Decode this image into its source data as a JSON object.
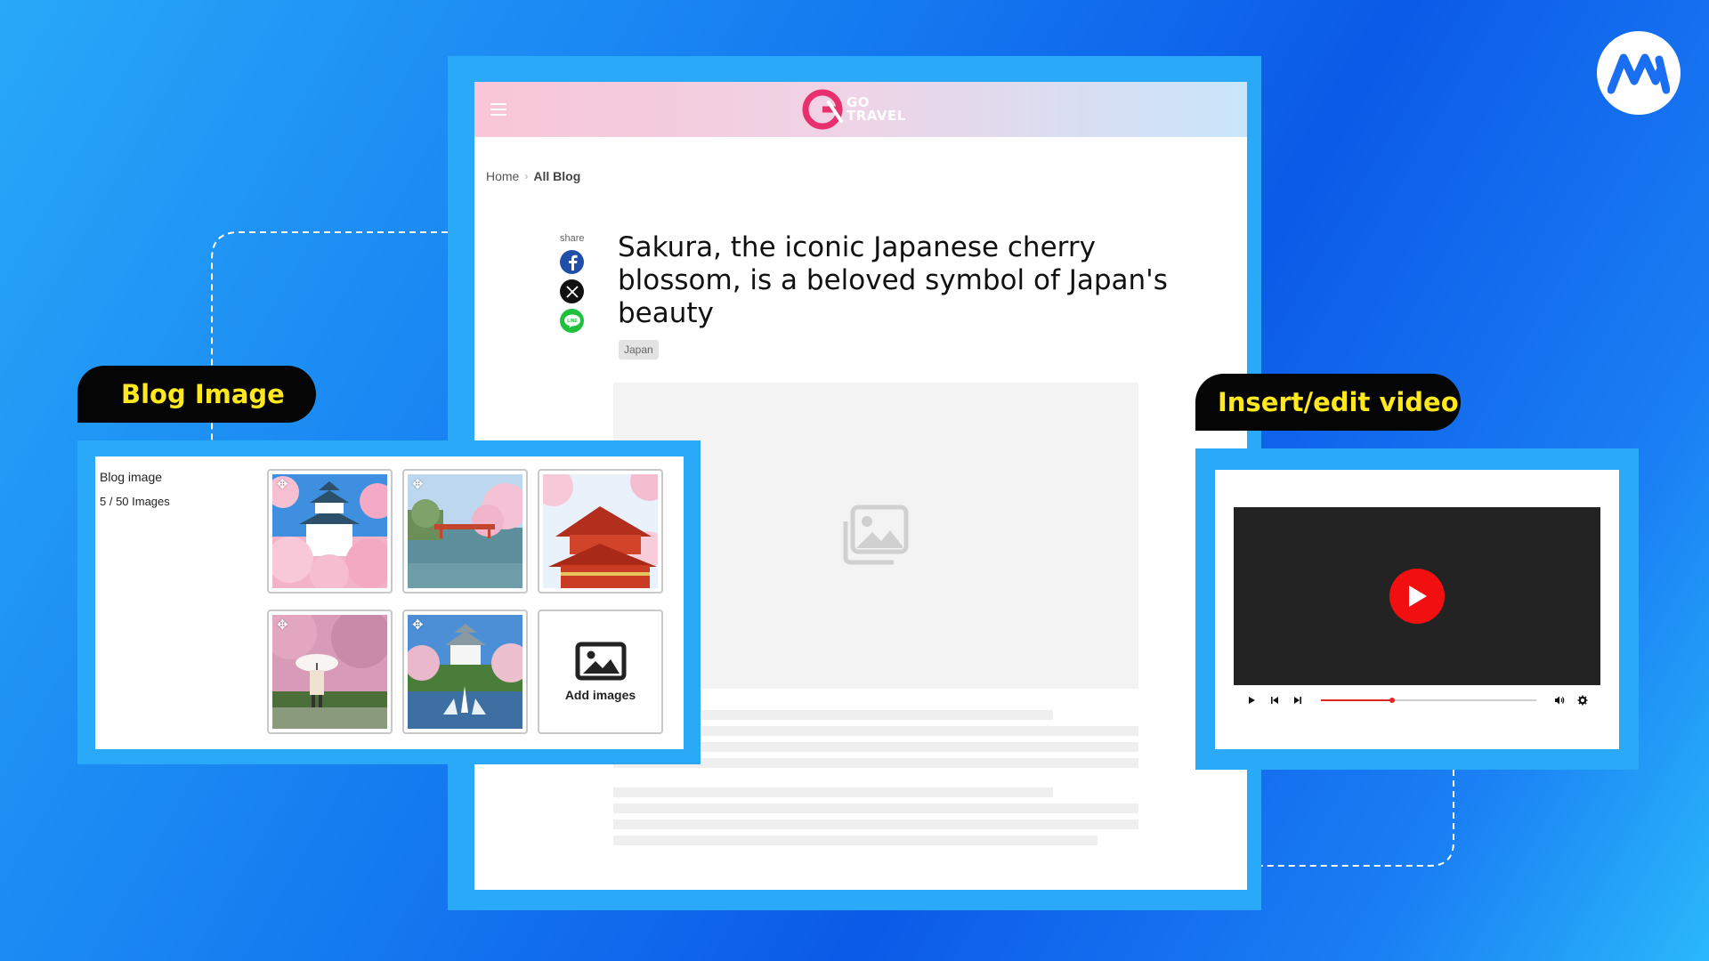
{
  "site": {
    "logo_line1": "GO",
    "logo_line2": "TRAVEL"
  },
  "breadcrumb": {
    "home": "Home",
    "separator": "›",
    "current": "All Blog"
  },
  "share": {
    "label": "share",
    "buttons": [
      "facebook-icon",
      "x-icon",
      "line-icon"
    ],
    "line_text": "LINE"
  },
  "article": {
    "title": "Sakura, the iconic Japanese cherry blossom, is a beloved symbol of Japan's beauty",
    "tag": "Japan"
  },
  "blog_image_panel": {
    "callout": "Blog Image",
    "title": "Blog image",
    "count": "5 / 50 Images",
    "images": [
      "castle-sakura",
      "river-bridge-sakura",
      "pagoda-sakura",
      "umbrella-sakura",
      "castle-fountain"
    ],
    "add_label": "Add images"
  },
  "video_panel": {
    "callout": "Insert/edit video",
    "progress": 0.33
  },
  "colors": {
    "accent_blue": "#29a9f7",
    "callout_text": "#ffe81d",
    "play_red": "#f20f0f",
    "logo_pink": "#e8306e"
  }
}
